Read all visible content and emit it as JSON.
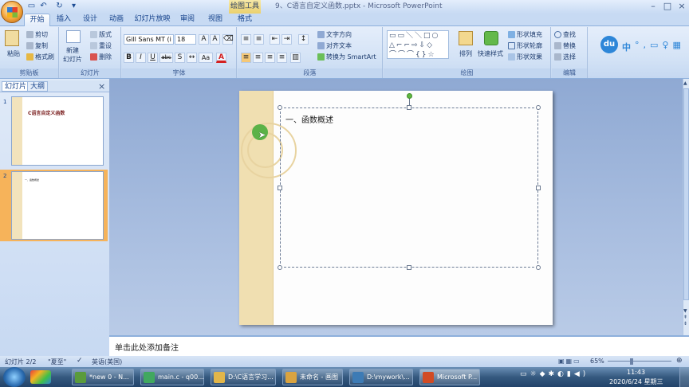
{
  "title_bar": {
    "context_group": "绘图工具",
    "window_title": "9、C语言自定义函数.pptx - Microsoft PowerPoint"
  },
  "quick_access": {
    "icons": [
      "save-icon",
      "undo-icon",
      "redo-icon",
      "customize-icon"
    ]
  },
  "tabs": [
    "开始",
    "插入",
    "设计",
    "动画",
    "幻灯片放映",
    "审阅",
    "视图",
    "格式"
  ],
  "ribbon": {
    "clipboard": {
      "label": "剪贴板",
      "paste": "粘贴",
      "cut": "剪切",
      "copy": "复制",
      "format_painter": "格式刷"
    },
    "slides": {
      "label": "幻灯片",
      "new_slide": "新建\n幻灯片",
      "layout": "版式",
      "reset": "重设",
      "delete": "删除"
    },
    "font": {
      "label": "字体",
      "font_name": "Gill Sans MT (i",
      "font_size": "18",
      "bold": "B",
      "italic": "I",
      "underline": "U",
      "strike": "abc",
      "shadow": "S",
      "aa": "Aa",
      "fontcolor": "A"
    },
    "paragraph": {
      "label": "段落",
      "text_direction": "文字方向",
      "align_text": "对齐文本",
      "smartart": "转换为 SmartArt"
    },
    "drawing": {
      "label": "绘图",
      "arrange": "排列",
      "quick_styles": "快速样式",
      "shape_fill": "形状填充",
      "shape_outline": "形状轮廓",
      "shape_effects": "形状效果"
    },
    "editing": {
      "label": "编辑",
      "find": "查找",
      "replace": "替换",
      "select": "选择"
    }
  },
  "left_pane": {
    "tab_slides": "幻灯片",
    "tab_outline": "大纲",
    "thumbnails": [
      {
        "num": "1",
        "title": "C语言自定义函数"
      },
      {
        "num": "2",
        "title": "一、函数概述"
      }
    ]
  },
  "slide": {
    "title_text": "一、函数概述"
  },
  "notes": {
    "placeholder": "单击此处添加备注"
  },
  "status_bar": {
    "slide_info": "幻灯片 2/2",
    "theme": "\"夏至\"",
    "language": "英语(美国)",
    "zoom": "65%"
  },
  "taskbar": {
    "items": [
      {
        "label": "*new 0 - N...",
        "color": "#5a9b3c"
      },
      {
        "label": "main.c - q00...",
        "color": "#41a85f"
      },
      {
        "label": "D:\\C语言学习...",
        "color": "#e2b64a"
      },
      {
        "label": "未命名 - 画图",
        "color": "#d9a340"
      },
      {
        "label": "D:\\mywork\\...",
        "color": "#3d7bb5"
      },
      {
        "label": "Microsoft P...",
        "color": "#d14b24"
      }
    ],
    "time": "11:43",
    "date": "2020/6/24 星期三"
  },
  "ime": {
    "logo": "du",
    "lang": "中"
  }
}
